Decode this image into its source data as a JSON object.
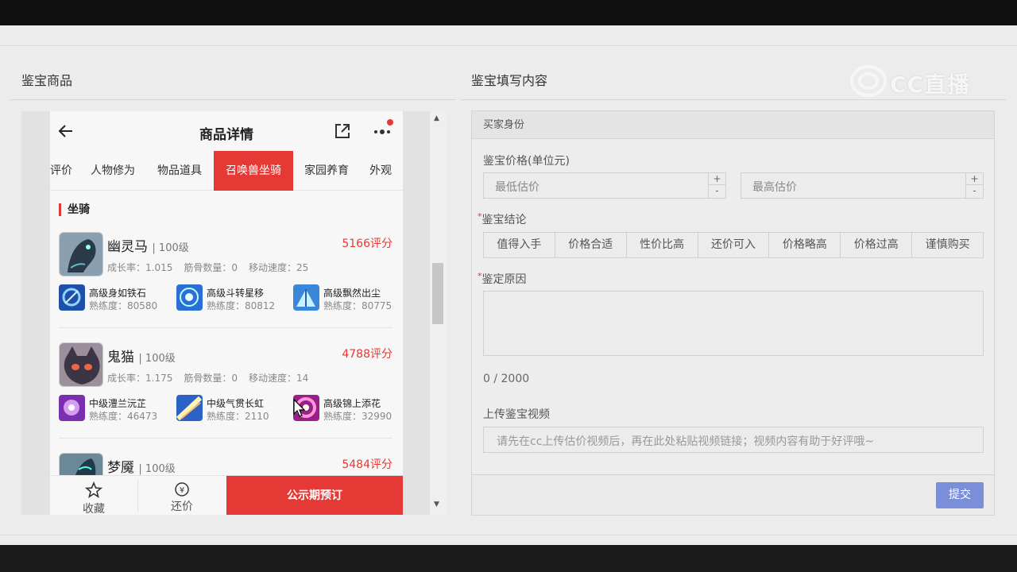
{
  "left": {
    "title": "鉴宝商品",
    "nav": {
      "title": "商品详情"
    },
    "tabs": [
      {
        "label": "评价",
        "active": false
      },
      {
        "label": "人物修为",
        "active": false
      },
      {
        "label": "物品道具",
        "active": false
      },
      {
        "label": "召唤兽坐骑",
        "active": true
      },
      {
        "label": "家园养育",
        "active": false
      },
      {
        "label": "外观",
        "active": false
      }
    ],
    "section": "坐骑",
    "pets": [
      {
        "name": "幽灵马",
        "level": "| 100级",
        "score": "5166评分",
        "stats": [
          "成长率：1.015",
          "筋骨数量：0",
          "移动速度：25"
        ],
        "skills": [
          {
            "name": "高级身如铁石",
            "exp": "熟练度：80580"
          },
          {
            "name": "高级斗转星移",
            "exp": "熟练度：80812"
          },
          {
            "name": "高级飘然出尘",
            "exp": "熟练度：80775"
          }
        ]
      },
      {
        "name": "鬼猫",
        "level": "| 100级",
        "score": "4788评分",
        "stats": [
          "成长率：1.175",
          "筋骨数量：0",
          "移动速度：14"
        ],
        "skills": [
          {
            "name": "中级澧兰沅芷",
            "exp": "熟练度：46473"
          },
          {
            "name": "中级气贯长虹",
            "exp": "熟练度：2110"
          },
          {
            "name": "高级锦上添花",
            "exp": "熟练度：32990"
          }
        ]
      },
      {
        "name": "梦魇",
        "level": "| 100级",
        "score": "5484评分",
        "stats": [],
        "skills": []
      }
    ],
    "bottom": {
      "fav": "收藏",
      "bargain": "还价",
      "buy": "公示期预订"
    }
  },
  "right": {
    "title": "鉴宝填写内容",
    "watermark": "CC直播",
    "form_head": "买家身份",
    "price_label": "鉴宝价格(单位元)",
    "min_placeholder": "最低估价",
    "max_placeholder": "最高估价",
    "conclusion_label": "鉴宝结论",
    "conclusions": [
      "值得入手",
      "价格合适",
      "性价比高",
      "还价可入",
      "价格略高",
      "价格过高",
      "谨慎购买"
    ],
    "reason_label": "鉴定原因",
    "counter": "0 / 2000",
    "video_label": "上传鉴宝视频",
    "video_placeholder": "请先在cc上传估价视频后，再在此处粘贴视频链接；视频内容有助于好评哦~",
    "submit": "提交"
  }
}
